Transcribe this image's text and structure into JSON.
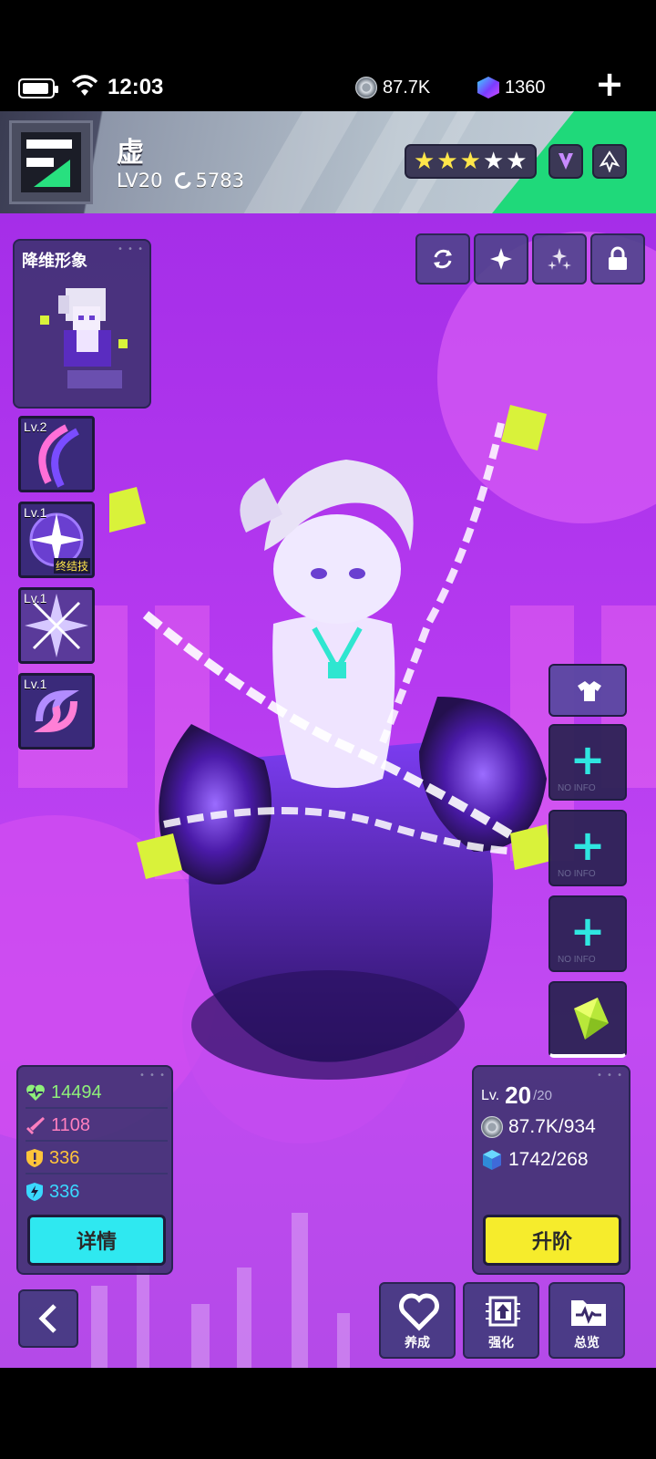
{
  "status_bar": {
    "time": "12:03"
  },
  "currencies": {
    "coins": "87.7K",
    "gems": "1360"
  },
  "hero": {
    "name": "虚",
    "level": "LV20",
    "power": "5783",
    "stars_filled": 3,
    "stars_total": 5
  },
  "portrait_panel": {
    "title": "降维形象"
  },
  "skills": [
    {
      "level": "Lv.2",
      "tag": ""
    },
    {
      "level": "Lv.1",
      "tag": "终结技"
    },
    {
      "level": "Lv.1",
      "tag": ""
    },
    {
      "level": "Lv.1",
      "tag": ""
    }
  ],
  "equipment_slots": [
    {
      "label": "NO INFO"
    },
    {
      "label": "NO INFO"
    },
    {
      "label": "NO INFO"
    }
  ],
  "stats": {
    "hp": "14494",
    "attack": "1108",
    "defense": "336",
    "energy": "336",
    "detail_button": "详情"
  },
  "level_panel": {
    "lv_prefix": "Lv.",
    "level": "20",
    "max_level": "/20",
    "coins_cost": "87.7K/934",
    "material_cost": "1742/268",
    "upgrade_button": "升阶"
  },
  "bottom_nav": {
    "nurture": "养成",
    "enhance": "强化",
    "overview": "总览"
  },
  "colors": {
    "accent_cyan": "#2fe8f0",
    "accent_yellow": "#f6ec2c",
    "scene_purple": "#b63af0",
    "hp_green": "#8ff07a",
    "atk_pink": "#ff7fbf",
    "def_yellow": "#ffc43a",
    "energy_cyan": "#3ad8ff"
  }
}
